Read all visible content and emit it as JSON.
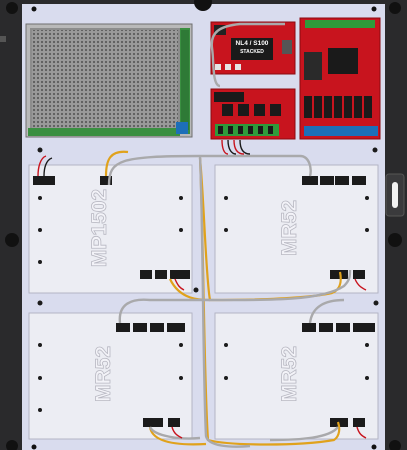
{
  "diagram": {
    "colors": {
      "enclosure": "#2a2a2c",
      "backplate": "#d9dcee",
      "board": "#ecedf3",
      "board_outline": "#b3b5c4",
      "psu": "#8d8d8d",
      "pcb_red": "#c8141e",
      "terminal_black": "#1b1b1b",
      "terminal_blue": "#1d6fb8",
      "terminal_green": "#2e9a3a",
      "cable_gray": "#a9a9ab",
      "cable_orange": "#e0a21c"
    },
    "components": {
      "nl4_label_line1": "NL4 / S100",
      "nl4_label_line2": "STACKED"
    },
    "boards": [
      {
        "label": "MP1502"
      },
      {
        "label": "MR52"
      },
      {
        "label": "MR52"
      },
      {
        "label": "MR52"
      }
    ]
  }
}
